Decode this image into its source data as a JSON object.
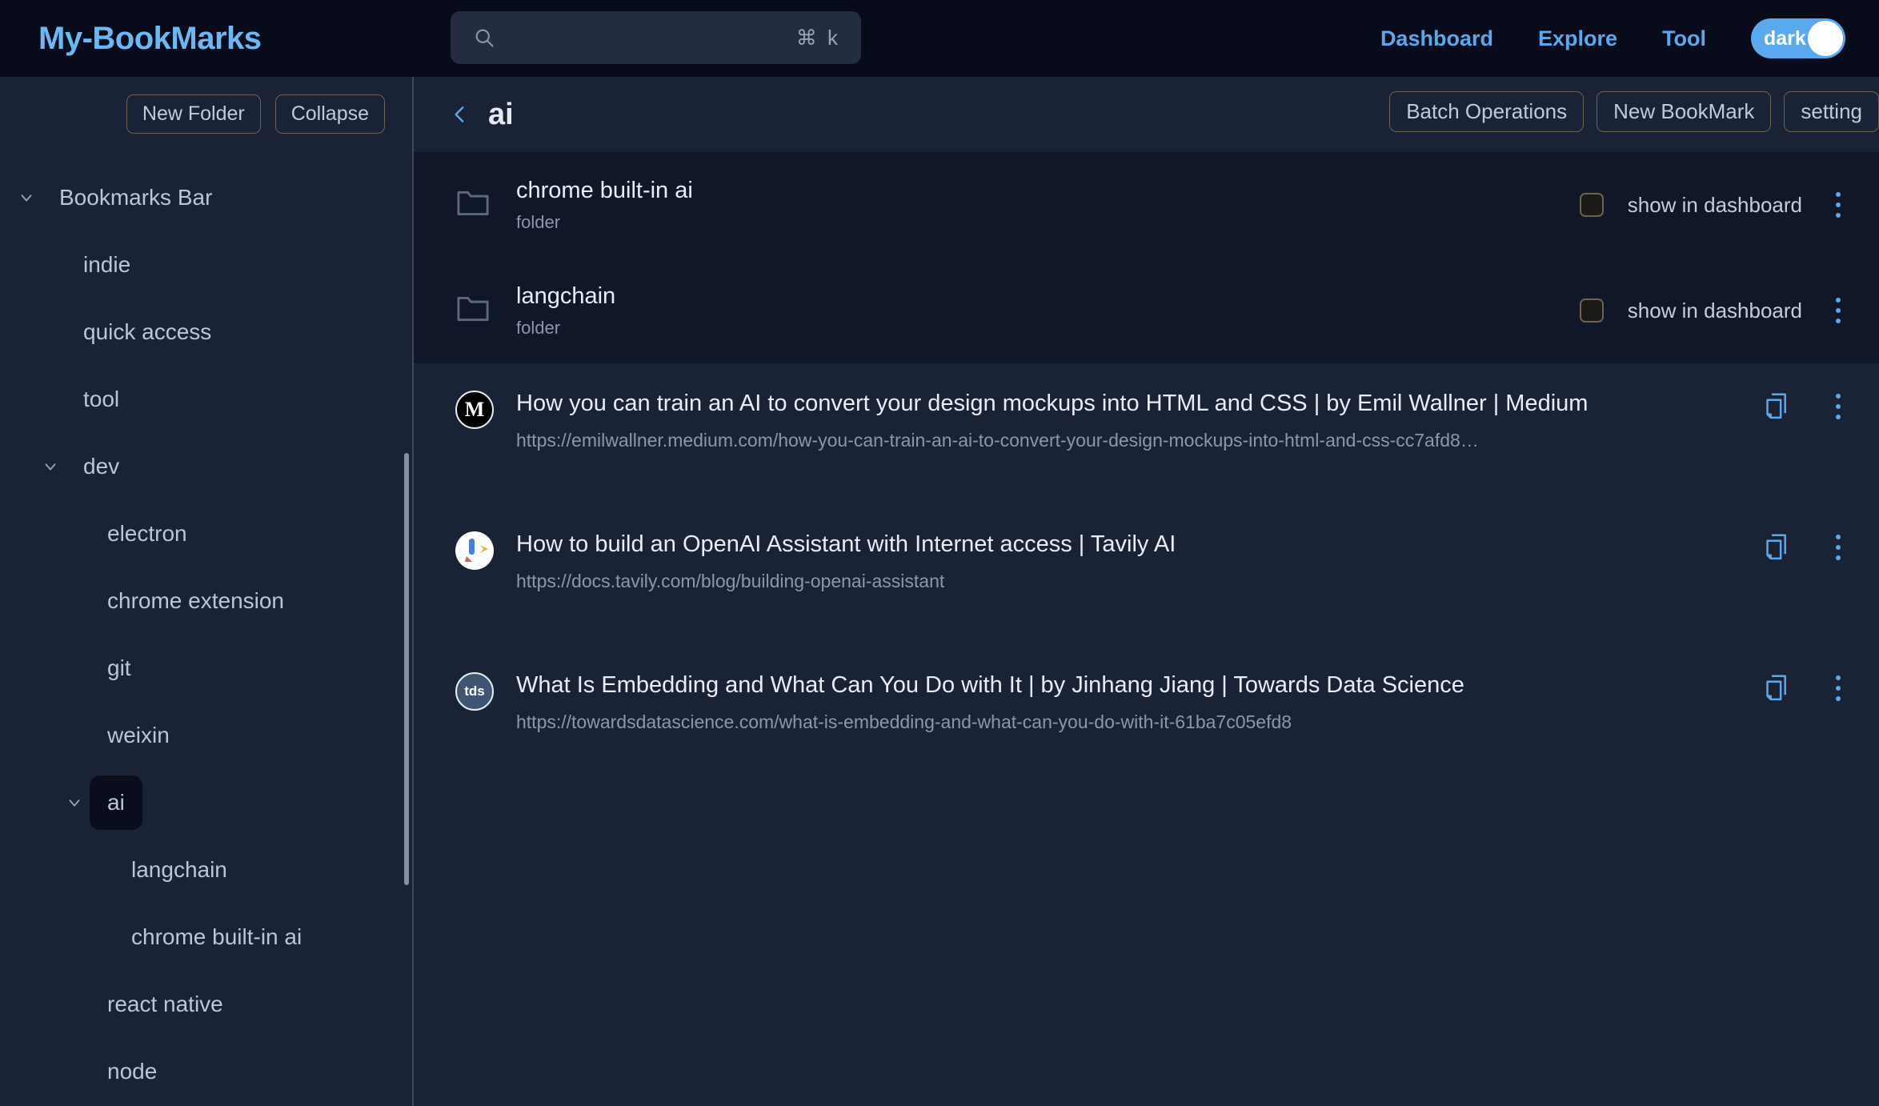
{
  "header": {
    "logo": "My-BookMarks",
    "search": {
      "value": "",
      "placeholder": "",
      "shortcut": "⌘ k",
      "icon": "search-icon"
    },
    "nav": [
      {
        "label": "Dashboard"
      },
      {
        "label": "Explore"
      },
      {
        "label": "Tool"
      }
    ],
    "theme_toggle": {
      "label": "dark",
      "state": "on",
      "accent": "#5aa9ef"
    }
  },
  "sidebar": {
    "actions": [
      {
        "label": "New Folder",
        "name": "new-folder-button"
      },
      {
        "label": "Collapse",
        "name": "collapse-button"
      }
    ],
    "tree": [
      {
        "label": "Bookmarks Bar",
        "depth": 0,
        "caret": "chevron-down",
        "selected": false
      },
      {
        "label": "indie",
        "depth": 1,
        "caret": "",
        "selected": false
      },
      {
        "label": "quick access",
        "depth": 1,
        "caret": "",
        "selected": false
      },
      {
        "label": "tool",
        "depth": 1,
        "caret": "",
        "selected": false
      },
      {
        "label": "dev",
        "depth": 1,
        "caret": "chevron-down",
        "selected": false
      },
      {
        "label": "electron",
        "depth": 2,
        "caret": "",
        "selected": false
      },
      {
        "label": "chrome extension",
        "depth": 2,
        "caret": "",
        "selected": false
      },
      {
        "label": "git",
        "depth": 2,
        "caret": "",
        "selected": false
      },
      {
        "label": "weixin",
        "depth": 2,
        "caret": "",
        "selected": false
      },
      {
        "label": "ai",
        "depth": 2,
        "caret": "chevron-down",
        "selected": true
      },
      {
        "label": "langchain",
        "depth": 3,
        "caret": "",
        "selected": false
      },
      {
        "label": "chrome built-in ai",
        "depth": 3,
        "caret": "",
        "selected": false
      },
      {
        "label": "react native",
        "depth": 2,
        "caret": "",
        "selected": false
      },
      {
        "label": "node",
        "depth": 2,
        "caret": "",
        "selected": false
      }
    ]
  },
  "content": {
    "back_icon": "chevron-left-icon",
    "title": "ai",
    "actions": [
      {
        "label": "Batch Operations",
        "name": "batch-operations-button"
      },
      {
        "label": "New BookMark",
        "name": "new-bookmark-button"
      },
      {
        "label": "setting",
        "name": "setting-button"
      }
    ],
    "folders": [
      {
        "name": "chrome built-in ai",
        "type": "folder",
        "checkbox_label": "show in dashboard",
        "checked": false
      },
      {
        "name": "langchain",
        "type": "folder",
        "checkbox_label": "show in dashboard",
        "checked": false
      }
    ],
    "bookmarks": [
      {
        "title": "How you can train an AI to convert your design mockups into HTML and CSS | by Emil Wallner | Medium",
        "url": "https://emilwallner.medium.com/how-you-can-train-an-ai-to-convert-your-design-mockups-into-html-and-css-cc7afd8…",
        "favicon": "medium-favicon",
        "favicon_text": "M"
      },
      {
        "title": "How to build an OpenAI Assistant with Internet access | Tavily AI",
        "url": "https://docs.tavily.com/blog/building-openai-assistant",
        "favicon": "tavily-favicon",
        "favicon_text": ""
      },
      {
        "title": "What Is Embedding and What Can You Do with It | by Jinhang Jiang | Towards Data Science",
        "url": "https://towardsdatascience.com/what-is-embedding-and-what-can-you-do-with-it-61ba7c05efd8",
        "favicon": "towards-data-science-favicon",
        "favicon_text": "tds"
      }
    ]
  },
  "colors": {
    "accent": "#5aa9ef",
    "page_bg": "#1a2236",
    "topbar_bg": "#080c1a",
    "folder_block_bg": "#101728",
    "selected_bg": "#090d1c"
  }
}
